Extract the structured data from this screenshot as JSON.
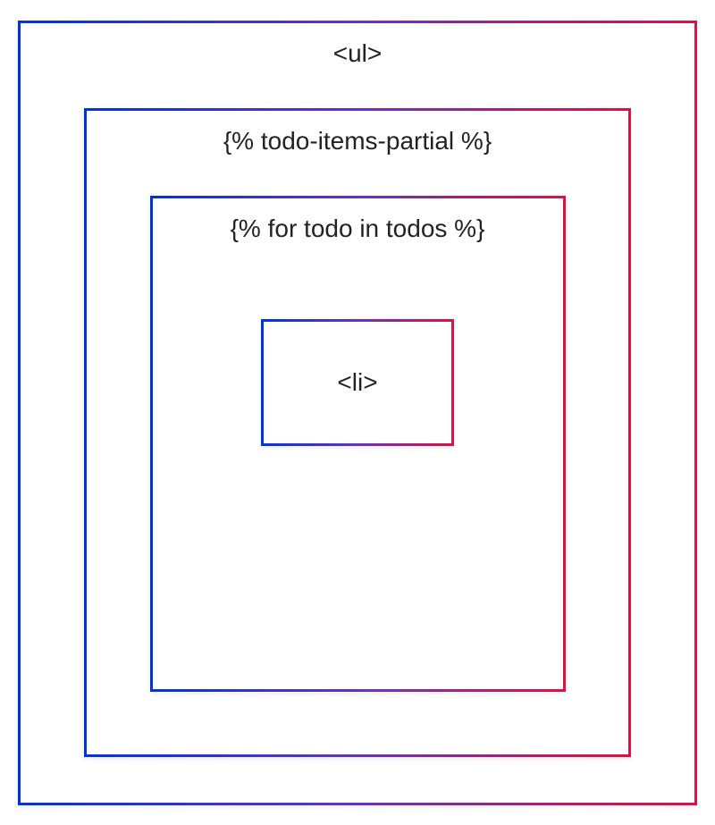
{
  "diagram": {
    "outer_label": "<ul>",
    "middle_label": "{% todo-items-partial %}",
    "inner_label": "{% for todo in todos %}",
    "innermost_label": "<li>"
  }
}
